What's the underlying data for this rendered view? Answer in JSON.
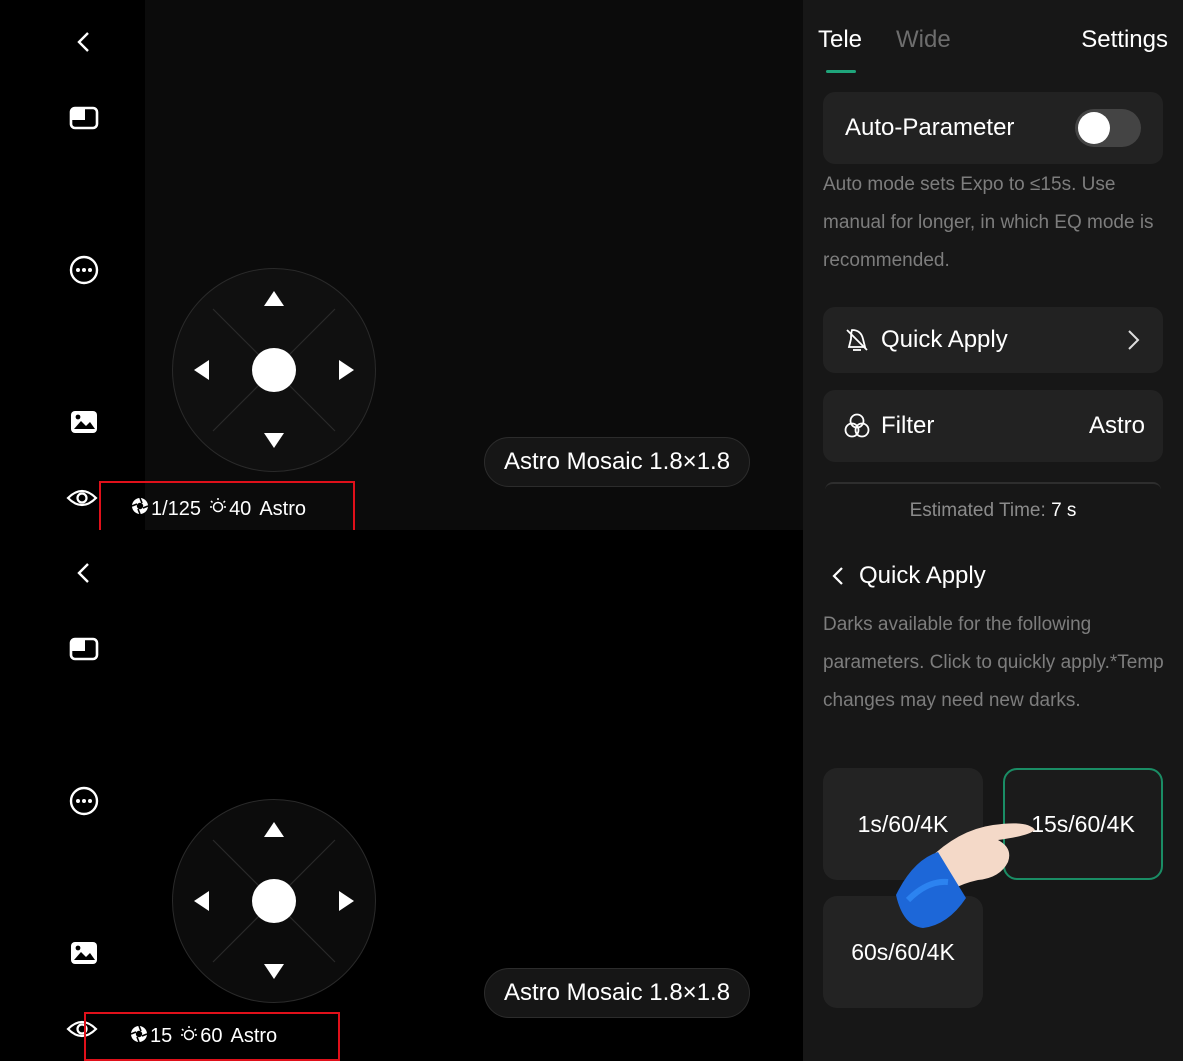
{
  "viewers": [
    {
      "mosaic_label": "Astro Mosaic 1.8×1.8",
      "status": {
        "shutter": "1/125",
        "gain": "40",
        "filter": "Astro"
      }
    },
    {
      "mosaic_label": "Astro Mosaic 1.8×1.8",
      "status": {
        "shutter": "15",
        "gain": "60",
        "filter": "Astro"
      }
    }
  ],
  "sidebar_icons": [
    "back-icon",
    "panel-icon",
    "more-icon",
    "gallery-icon",
    "eye-icon"
  ],
  "panel": {
    "tabs": [
      "Tele",
      "Wide"
    ],
    "active_tab": "Tele",
    "settings": "Settings",
    "auto_parameter": {
      "label": "Auto-Parameter",
      "enabled": false
    },
    "auto_hint": "Auto mode sets Expo to ≤15s. Use manual for longer, in which EQ mode is recommended.",
    "quick_apply": "Quick Apply",
    "filter": {
      "label": "Filter",
      "value": "Astro"
    },
    "estimated_label": "Estimated Time:",
    "estimated_value": "7 s",
    "quick_apply_header": "Quick Apply",
    "quick_apply_hint": "Darks available for the following parameters. Click to quickly apply.*Temp changes may need new darks.",
    "options": [
      "1s/60/4K",
      "15s/60/4K",
      "60s/60/4K"
    ],
    "selected_option": "15s/60/4K"
  },
  "colors": {
    "accent": "#1fa57b",
    "highlight_box": "#e0101a",
    "panel_bg": "#171717"
  }
}
